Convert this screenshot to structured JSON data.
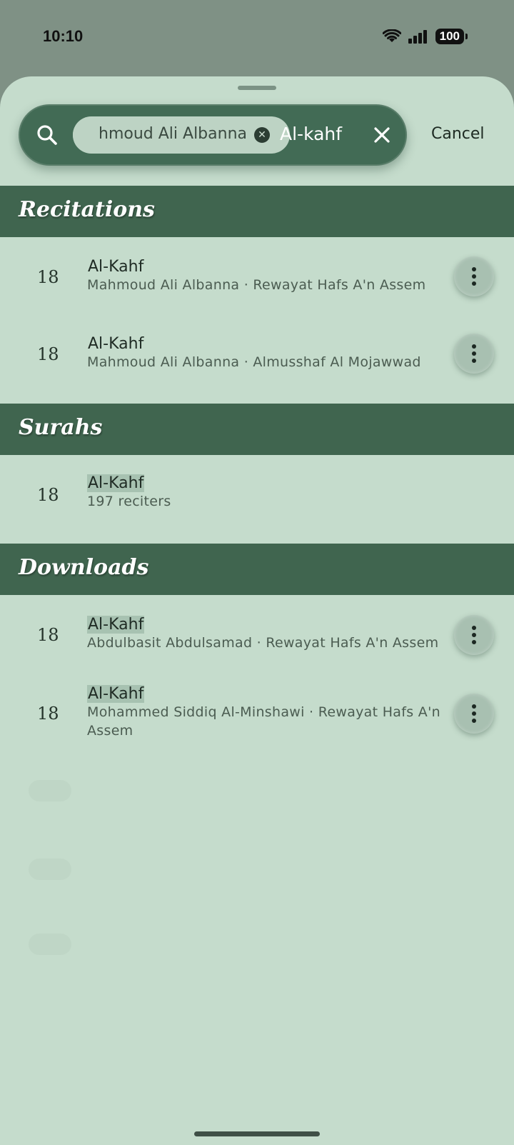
{
  "status": {
    "time": "10:10",
    "battery": "100",
    "icons": [
      "wifi-icon",
      "cellular-signal-icon",
      "battery-icon"
    ]
  },
  "search": {
    "token_label": "Mahmoud Ali  Albanna",
    "token_visible": "hmoud Ali  Albanna",
    "query": "Al-kahf",
    "cancel_label": "Cancel"
  },
  "sections": {
    "recitations": {
      "title": "Recitations",
      "items": [
        {
          "number": "18",
          "title": "Al-Kahf",
          "subtitle": "Mahmoud Ali  Albanna · Rewayat Hafs A'n Assem"
        },
        {
          "number": "18",
          "title": "Al-Kahf",
          "subtitle": "Mahmoud Ali  Albanna · Almusshaf Al Mojawwad"
        }
      ]
    },
    "surahs": {
      "title": "Surahs",
      "items": [
        {
          "number": "18",
          "title": "Al-Kahf",
          "subtitle": "197 reciters"
        }
      ]
    },
    "downloads": {
      "title": "Downloads",
      "items": [
        {
          "number": "18",
          "title": "Al-Kahf",
          "subtitle": "Abdulbasit Abdulsamad · Rewayat Hafs A'n Assem"
        },
        {
          "number": "18",
          "title": "Al-Kahf",
          "subtitle": "Mohammed Siddiq Al-Minshawi · Rewayat Hafs A'n Assem"
        }
      ]
    }
  },
  "colors": {
    "sheet_background": "#c5dccc",
    "section_header": "#40654f",
    "search_pill": "#426b55",
    "highlight": "#a7c2b1"
  }
}
